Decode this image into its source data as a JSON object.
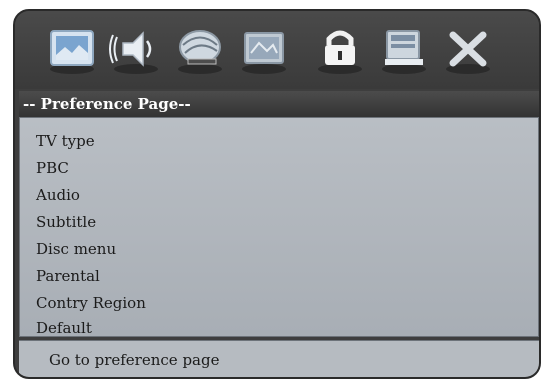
{
  "toolbar": {
    "icons": [
      "general-setup-icon",
      "audio-setup-icon",
      "dolby-digital-setup-icon",
      "video-setup-icon",
      "password-lock-icon",
      "preference-icon",
      "exit-setup-icon"
    ]
  },
  "header": {
    "title": "-- Preference  Page--"
  },
  "menu": {
    "items": [
      {
        "label": "TV type"
      },
      {
        "label": "PBC"
      },
      {
        "label": "Audio"
      },
      {
        "label": "Subtitle"
      },
      {
        "label": "Disc menu"
      },
      {
        "label": "Parental"
      },
      {
        "label": "Contry Region"
      },
      {
        "label": "Default"
      }
    ]
  },
  "status": {
    "text": "Go to preference page"
  }
}
